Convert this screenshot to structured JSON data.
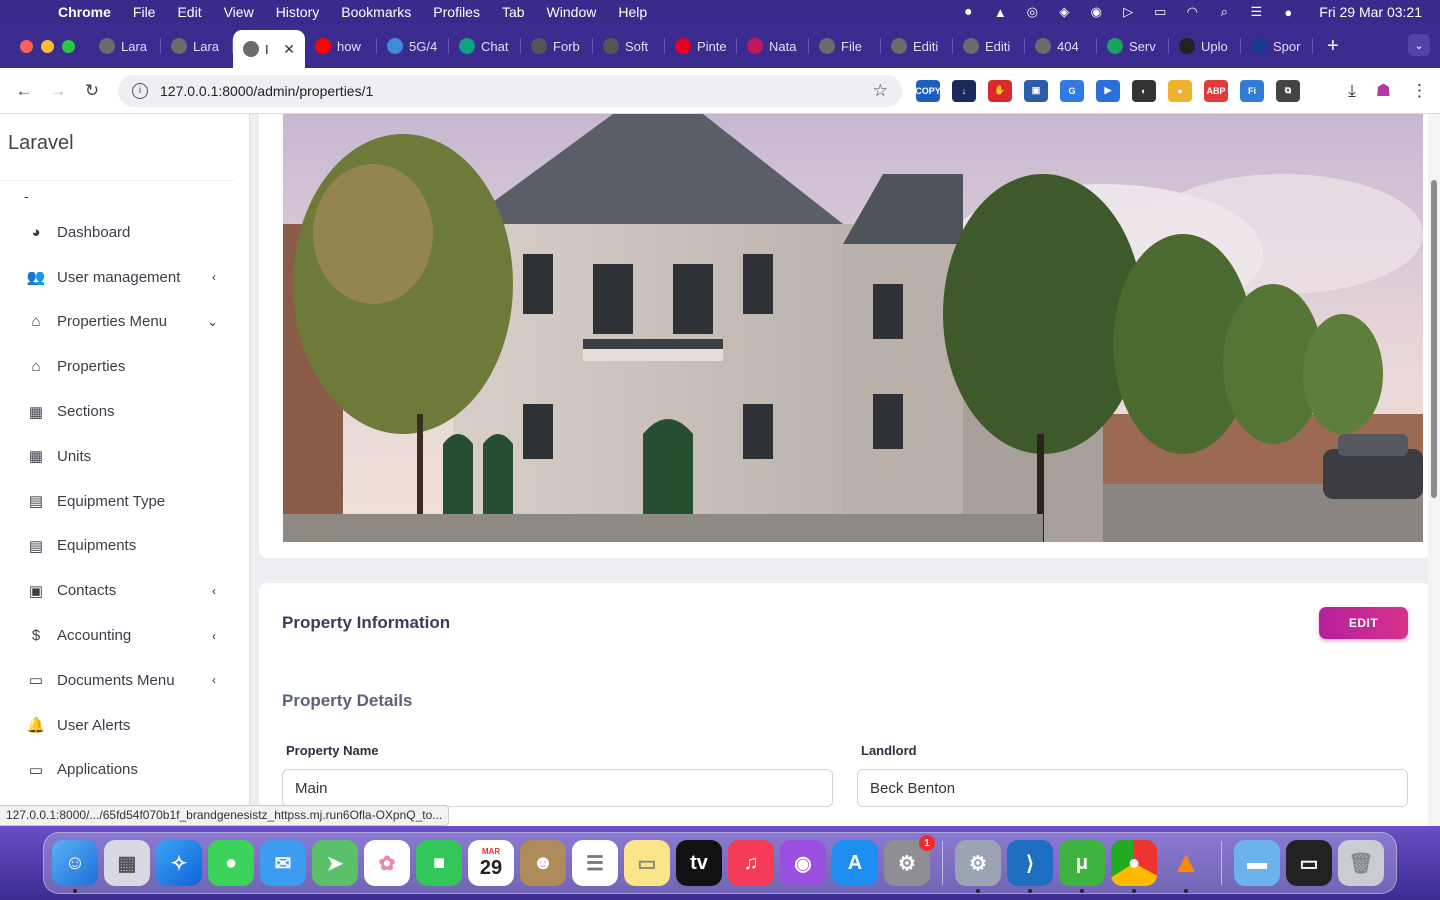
{
  "menubar": {
    "app": "Chrome",
    "items": [
      "File",
      "Edit",
      "View",
      "History",
      "Bookmarks",
      "Profiles",
      "Tab",
      "Window",
      "Help"
    ],
    "clock": "Fri 29 Mar  03:21"
  },
  "tabs": [
    {
      "label": "Lara",
      "color": "#6b6b6b"
    },
    {
      "label": "Lara",
      "color": "#6b6b6b"
    },
    {
      "label": "I",
      "color": "#6b6b6b",
      "active": true
    },
    {
      "label": "how",
      "color": "#ff0000"
    },
    {
      "label": "5G/4",
      "color": "#3d8bd9"
    },
    {
      "label": "Chat",
      "color": "#10a37f"
    },
    {
      "label": "Forb",
      "color": "#555555"
    },
    {
      "label": "Soft",
      "color": "#555555"
    },
    {
      "label": "Pinte",
      "color": "#e60023"
    },
    {
      "label": "Nata",
      "color": "#c2185b"
    },
    {
      "label": "File",
      "color": "#6b6b6b"
    },
    {
      "label": "Editi",
      "color": "#6b6b6b"
    },
    {
      "label": "Editi",
      "color": "#6b6b6b"
    },
    {
      "label": "404",
      "color": "#6b6b6b"
    },
    {
      "label": "Serv",
      "color": "#1aa260"
    },
    {
      "label": "Uplo",
      "color": "#222222"
    },
    {
      "label": "Spor",
      "color": "#1a3a8f"
    }
  ],
  "address": {
    "url": "127.0.0.1:8000/admin/properties/1"
  },
  "extensions": [
    {
      "name": "copy-extension-icon",
      "color": "#1f5fbf",
      "text": "COPY"
    },
    {
      "name": "downloader-extension-icon",
      "color": "#1b2a5c",
      "text": "↓"
    },
    {
      "name": "stop-extension-icon",
      "color": "#d92b2b",
      "text": "✋"
    },
    {
      "name": "save-extension-icon",
      "color": "#2d5ca8",
      "text": "▣"
    },
    {
      "name": "translate-extension-icon",
      "color": "#2e7be4",
      "text": "G"
    },
    {
      "name": "play-extension-icon",
      "color": "#2a6fdb",
      "text": "▶"
    },
    {
      "name": "flame-extension-icon",
      "color": "#333333",
      "text": "◐"
    },
    {
      "name": "cookie-extension-icon",
      "color": "#f0b030",
      "text": "●"
    },
    {
      "name": "adblock-extension-icon",
      "color": "#e03a3a",
      "text": "ABP"
    },
    {
      "name": "font-extension-icon",
      "color": "#2f7bd6",
      "text": "Fi"
    },
    {
      "name": "puzzle-extension-icon",
      "color": "#444444",
      "text": "⧉"
    }
  ],
  "sidebar": {
    "brand": "Laravel",
    "dash_mark": "-",
    "items": [
      {
        "label": "Dashboard",
        "icon": "gauge-icon",
        "glyph": "◕",
        "indicator": ""
      },
      {
        "label": "User management",
        "icon": "users-icon",
        "glyph": "👥",
        "indicator": "‹"
      },
      {
        "label": "Properties Menu",
        "icon": "home-icon",
        "glyph": "⌂",
        "indicator": "⌄"
      },
      {
        "label": "Properties",
        "icon": "home-icon",
        "glyph": "⌂",
        "indicator": ""
      },
      {
        "label": "Sections",
        "icon": "building-icon",
        "glyph": "▦",
        "indicator": ""
      },
      {
        "label": "Units",
        "icon": "building-icon",
        "glyph": "▦",
        "indicator": ""
      },
      {
        "label": "Equipment Type",
        "icon": "grid-icon",
        "glyph": "▤",
        "indicator": ""
      },
      {
        "label": "Equipments",
        "icon": "grid-icon",
        "glyph": "▤",
        "indicator": ""
      },
      {
        "label": "Contacts",
        "icon": "contact-book-icon",
        "glyph": "▣",
        "indicator": "‹"
      },
      {
        "label": "Accounting",
        "icon": "dollar-icon",
        "glyph": "$",
        "indicator": "‹"
      },
      {
        "label": "Documents Menu",
        "icon": "folder-icon",
        "glyph": "▭",
        "indicator": "‹"
      },
      {
        "label": "User Alerts",
        "icon": "bell-icon",
        "glyph": "🔔",
        "indicator": ""
      },
      {
        "label": "Applications",
        "icon": "folder-open-icon",
        "glyph": "▭",
        "indicator": ""
      }
    ]
  },
  "status_url": "127.0.0.1:8000/.../65fd54f070b1f_brandgenesistz_httpss.mj.run6Ofla-OXpnQ_to...",
  "main": {
    "card_title": "Property Information",
    "edit_label": "EDIT",
    "section_title": "Property Details",
    "fields": [
      {
        "label": "Property Name",
        "value": "Main"
      },
      {
        "label": "Landlord",
        "value": "Beck Benton"
      }
    ]
  },
  "dock": {
    "calendar_month": "MAR",
    "calendar_day": "29",
    "settings_badge": "1"
  },
  "colors": {
    "accent": "#c3268f",
    "menubar": "#3a2a8c"
  }
}
